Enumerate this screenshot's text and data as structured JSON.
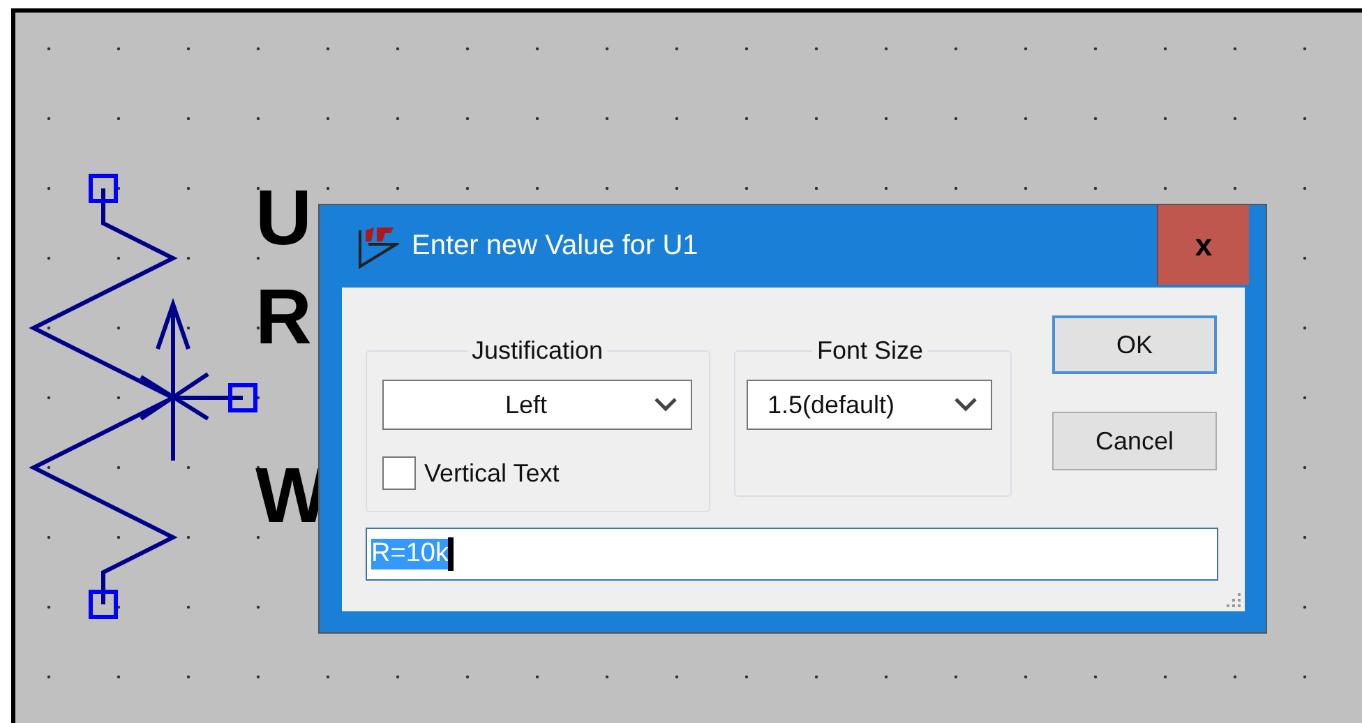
{
  "schematic": {
    "labels": [
      "U",
      "R",
      "W"
    ]
  },
  "dialog": {
    "title": "Enter new Value for U1",
    "close": "x",
    "justification": {
      "label": "Justification",
      "value": "Left",
      "vertical_text": {
        "label": "Vertical Text",
        "checked": false
      }
    },
    "font_size": {
      "label": "Font Size",
      "value": "1.5(default)"
    },
    "buttons": [
      {
        "label": "OK",
        "default": true
      },
      {
        "label": "Cancel",
        "default": false
      }
    ],
    "field": {
      "value": "R=10k",
      "text_selected": true
    }
  }
}
